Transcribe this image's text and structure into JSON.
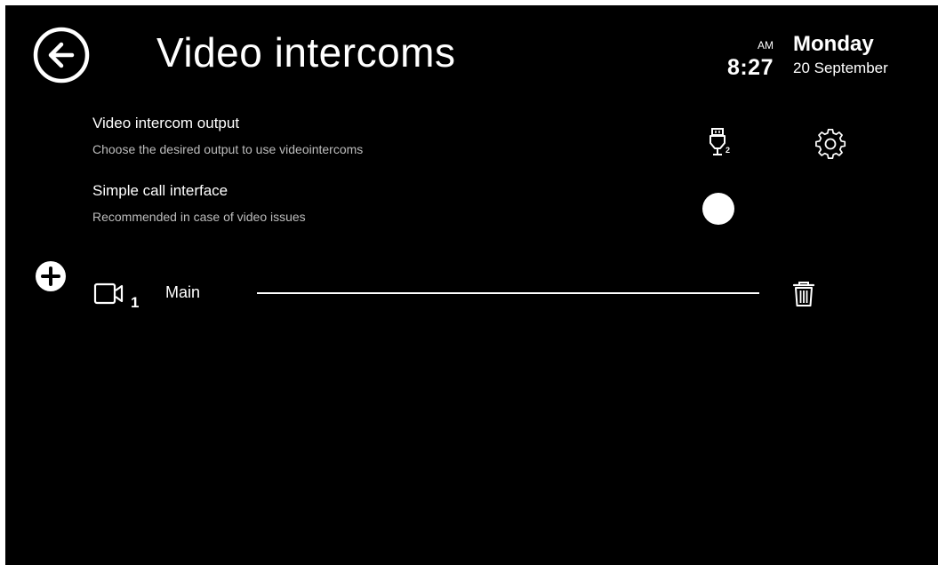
{
  "header": {
    "title": "Video intercoms",
    "ampm": "AM",
    "time": "8:27",
    "day": "Monday",
    "date": "20 September"
  },
  "settings": [
    {
      "title": "Video intercom output",
      "description": "Choose the desired output to use videointercoms",
      "output_icon": "usb-plug-icon",
      "output_badge": "2",
      "settings_icon": "gear-icon"
    },
    {
      "title": "Simple call interface",
      "description": "Recommended in case of video issues",
      "control": "toggle"
    }
  ],
  "intercoms": [
    {
      "icon": "camera-icon",
      "number": "1",
      "name": "Main",
      "delete_icon": "trash-icon"
    }
  ],
  "add_icon": "plus-circle-icon",
  "colors": {
    "background": "#000000",
    "foreground": "#ffffff",
    "secondary_text": "#bdbdbd"
  }
}
